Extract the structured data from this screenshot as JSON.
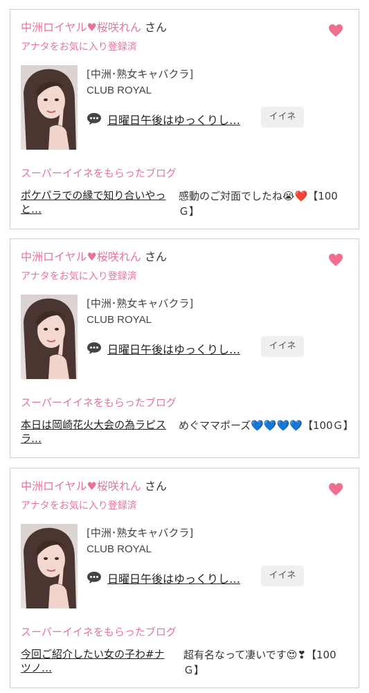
{
  "cards": [
    {
      "cast_name": "中洲ロイヤル",
      "cast_name2": "桜咲れん",
      "honorific": "さん",
      "fav_status": "アナタをお気に入り登録済",
      "shop_category": "[中洲･熟女キャバクラ]",
      "shop_name": "CLUB ROYAL",
      "blog_title": "日曜日午後はゆっくりし…",
      "iine_label": "イイネ",
      "section_label": "スーパーイイネをもらったブログ",
      "super_blog_title": "ポケパラでの縁で知り合いやっと…",
      "super_comment": "感動のご対面でしたね😭❤️【100Ｇ】"
    },
    {
      "cast_name": "中洲ロイヤル",
      "cast_name2": "桜咲れん",
      "honorific": "さん",
      "fav_status": "アナタをお気に入り登録済",
      "shop_category": "[中洲･熟女キャバクラ]",
      "shop_name": "CLUB ROYAL",
      "blog_title": "日曜日午後はゆっくりし…",
      "iine_label": "イイネ",
      "section_label": "スーパーイイネをもらったブログ",
      "super_blog_title": "本日は岡崎花火大会の為ラピスラ…",
      "super_comment": "めぐママポーズ💙💙💙💙【100Ｇ】"
    },
    {
      "cast_name": "中洲ロイヤル",
      "cast_name2": "桜咲れん",
      "honorific": "さん",
      "fav_status": "アナタをお気に入り登録済",
      "shop_category": "[中洲･熟女キャバクラ]",
      "shop_name": "CLUB ROYAL",
      "blog_title": "日曜日午後はゆっくりし…",
      "iine_label": "イイネ",
      "section_label": "スーパーイイネをもらったブログ",
      "super_blog_title": "今回ご紹介したい女の子わ#ナツノ…",
      "super_comment": "超有名なって凄いです😍❣【100Ｇ】"
    }
  ],
  "icons": {
    "heart": "heart-icon",
    "comment": "speech-bubble-icon"
  },
  "colors": {
    "accent_pink": "#e8739a",
    "heart_pink": "#f06e8e",
    "border": "#cfcfcf",
    "button_bg": "#efefef"
  }
}
